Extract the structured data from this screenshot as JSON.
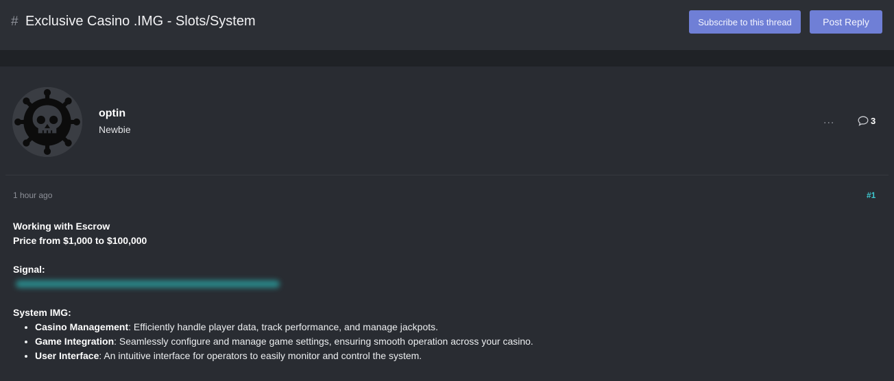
{
  "header": {
    "hash": "#",
    "title": "Exclusive Casino .IMG - Slots/System",
    "subscribe_label": "Subscribe to this thread",
    "reply_label": "Post Reply"
  },
  "author": {
    "username": "optin",
    "rank": "Newbie",
    "avatar_icon": "skull-virus-icon"
  },
  "actions": {
    "more_label": "...",
    "comment_icon": "speech-bubble-icon",
    "comment_count": "3"
  },
  "post": {
    "time": "1 hour ago",
    "number": "#1",
    "line1": "Working with Escrow",
    "line2": "Price from $1,000 to $100,000",
    "signal_label": "Signal:",
    "system_label": "System IMG:",
    "features": [
      {
        "name": "Casino Management",
        "text": ": Efficiently handle player data, track performance, and manage jackpots."
      },
      {
        "name": "Game Integration",
        "text": ": Seamlessly configure and manage game settings, ensuring smooth operation across your casino."
      },
      {
        "name": "User Interface",
        "text": ": An intuitive interface for operators to easily monitor and control the system."
      }
    ]
  },
  "colors": {
    "accent_button": "#6f7fd6",
    "post_number": "#3ec8d0",
    "background": "#2a2d33"
  }
}
